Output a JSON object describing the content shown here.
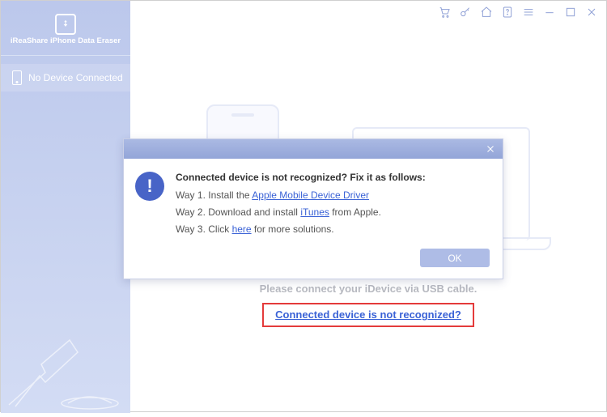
{
  "app": {
    "title": "iReaShare iPhone Data Eraser"
  },
  "sidebar": {
    "status": "No Device Connected"
  },
  "titlebar": {
    "cart": "cart-icon",
    "key": "key-icon",
    "home": "home-icon",
    "help": "help-icon",
    "menu": "menu-icon",
    "minimize": "minimize-icon",
    "maximize": "maximize-icon",
    "close": "close-icon"
  },
  "main": {
    "prompt": "Please connect your iDevice via USB cable.",
    "not_recognized_link": "Connected device is not recognized?"
  },
  "dialog": {
    "title": "Connected device is not recognized? Fix it as follows:",
    "way1_prefix": "Way 1. Install the ",
    "way1_link": "Apple Mobile Device Driver",
    "way2_prefix": "Way 2. Download and install ",
    "way2_link": "iTunes",
    "way2_suffix": " from Apple.",
    "way3_prefix": "Way 3. Click ",
    "way3_link": "here",
    "way3_suffix": " for more solutions.",
    "ok": "OK"
  }
}
